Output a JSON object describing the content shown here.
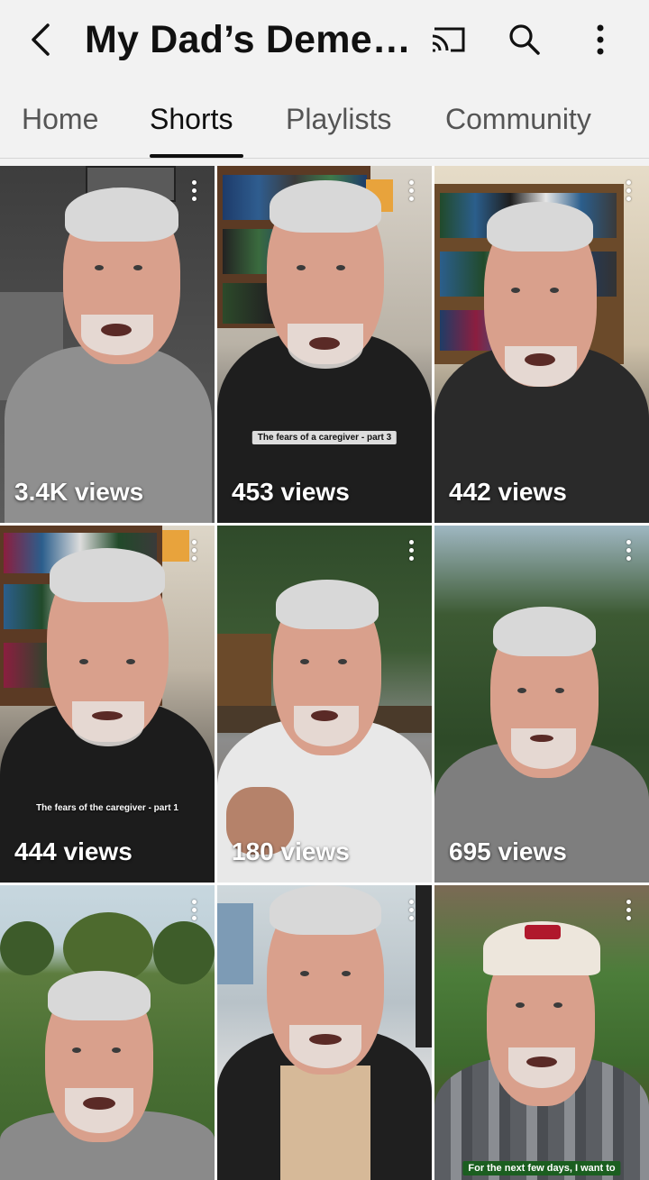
{
  "header": {
    "title": "My Dad’s Deme…",
    "back_icon": "back-arrow-icon",
    "cast_icon": "cast-icon",
    "search_icon": "search-icon",
    "more_icon": "more-vert-icon"
  },
  "tabs": [
    {
      "label": "Home",
      "active": false
    },
    {
      "label": "Shorts",
      "active": true
    },
    {
      "label": "Playlists",
      "active": false
    },
    {
      "label": "Community",
      "active": false
    }
  ],
  "shorts": [
    {
      "views": "3.4K views",
      "caption": ""
    },
    {
      "views": "453 views",
      "caption": "The fears of a caregiver - part 3"
    },
    {
      "views": "442 views",
      "caption": ""
    },
    {
      "views": "444 views",
      "caption": "The fears of the caregiver - part 1"
    },
    {
      "views": "180 views",
      "caption": ""
    },
    {
      "views": "695 views",
      "caption": ""
    },
    {
      "views": "",
      "caption": ""
    },
    {
      "views": "",
      "caption": ""
    },
    {
      "views": "",
      "caption": "For the next few days, I want to"
    }
  ],
  "colors": {
    "background": "#f2f2f2",
    "text_primary": "#0f0f0f",
    "text_secondary": "#555555"
  }
}
